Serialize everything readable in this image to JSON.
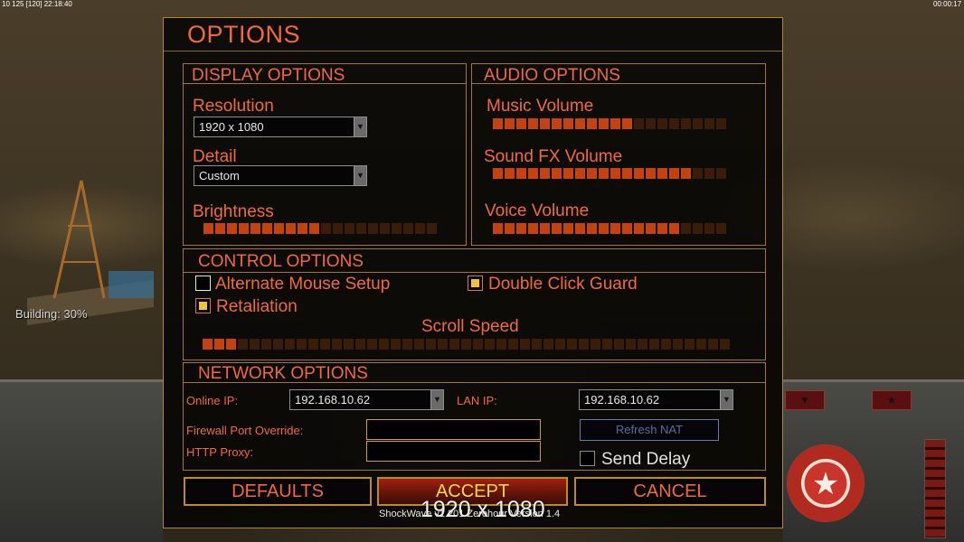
{
  "hud": {
    "top_left_stats": "10 125 [120] 22:18:40",
    "top_right_time": "00:00:17",
    "building_status": "Building: 30%"
  },
  "options": {
    "title": "OPTIONS",
    "display": {
      "heading": "DISPLAY OPTIONS",
      "resolution_label": "Resolution",
      "resolution_value": "1920 x 1080",
      "detail_label": "Detail",
      "detail_value": "Custom",
      "brightness_label": "Brightness",
      "brightness_level": 0.5
    },
    "audio": {
      "heading": "AUDIO OPTIONS",
      "music_label": "Music Volume",
      "music_level": 0.6,
      "sfx_label": "Sound FX Volume",
      "sfx_level": 0.85,
      "voice_label": "Voice Volume",
      "voice_level": 0.8
    },
    "control": {
      "heading": "CONTROL OPTIONS",
      "alt_mouse_label": "Alternate Mouse Setup",
      "alt_mouse_checked": false,
      "double_click_label": "Double Click Guard",
      "double_click_checked": true,
      "retaliation_label": "Retaliation",
      "retaliation_checked": true,
      "scroll_label": "Scroll Speed",
      "scroll_level": 0.07
    },
    "network": {
      "heading": "NETWORK OPTIONS",
      "online_ip_label": "Online IP:",
      "online_ip_value": "192.168.10.62",
      "lan_ip_label": "LAN IP:",
      "lan_ip_value": "192.168.10.62",
      "firewall_label": "Firewall Port Override:",
      "firewall_value": "",
      "proxy_label": "HTTP Proxy:",
      "proxy_value": "",
      "refresh_nat_label": "Refresh NAT",
      "send_delay_label": "Send Delay",
      "send_delay_checked": false
    },
    "buttons": {
      "defaults": "DEFAULTS",
      "accept": "ACCEPT",
      "cancel": "CANCEL"
    },
    "tooltip": "1920 x 1080",
    "version": "ShockWave v1.201 Zerohour Version 1.4"
  },
  "colors": {
    "accent_text": "#f06a36",
    "frame_gold": "#b8861a",
    "slider_on": "#c4420e",
    "slider_off": "#3a1d08",
    "check_fill": "#f2c23a"
  }
}
